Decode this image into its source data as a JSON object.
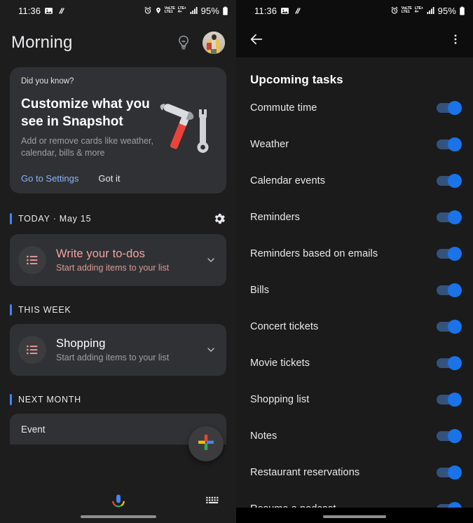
{
  "status_bar": {
    "time": "11:36",
    "icons_left": [
      "image-icon",
      "do-not-disturb-slash-icon"
    ],
    "alarm_icon": "alarm-icon",
    "location_icon": "location-pin-icon",
    "network_line1": "VoLTE",
    "network_line2": "LTE1",
    "network_badge1": "LTE+",
    "network_badge2": "4+",
    "signal_icon": "signal-bars-icon",
    "battery_text": "95%",
    "battery_icon": "battery-icon"
  },
  "left_screen": {
    "greeting": "Morning",
    "bulb_icon": "lightbulb-icon",
    "avatar_label": "account-avatar",
    "promo": {
      "eyebrow": "Did you know?",
      "title": "Customize what you see in Snapshot",
      "subtitle": "Add or remove cards like weather, calendar, bills & more",
      "primary_action": "Go to Settings",
      "secondary_action": "Got it",
      "art": "hammer-and-wrench-illustration"
    },
    "sections": [
      {
        "label": "TODAY · May 15",
        "has_gear": true,
        "gear_icon": "settings-gear-icon",
        "card": {
          "title": "Write your to-dos",
          "subtitle": "Start adding items to your list",
          "icon": "bullet-list-icon",
          "accent": "pink",
          "chevron": "chevron-down-icon"
        }
      },
      {
        "label": "THIS WEEK",
        "has_gear": false,
        "card": {
          "title": "Shopping",
          "subtitle": "Start adding items to your list",
          "icon": "bullet-list-icon",
          "accent": "white",
          "chevron": "chevron-down-icon"
        }
      },
      {
        "label": "NEXT MONTH",
        "has_gear": false,
        "event_card_label": "Event"
      }
    ],
    "fab": {
      "icon": "google-plus-add-icon",
      "label": "add"
    },
    "bottom_bar": {
      "mic_icon": "google-assistant-mic-icon",
      "keyboard_icon": "keyboard-icon"
    },
    "accent_color": "#4285f4",
    "card_color": "#303134",
    "background_color": "#1d1d1d"
  },
  "right_screen": {
    "back_icon": "back-arrow-icon",
    "overflow_icon": "more-vertical-icon",
    "title": "Upcoming tasks",
    "toggle_on_color": "#1a73e8",
    "items": [
      {
        "label": "Commute time",
        "enabled": true
      },
      {
        "label": "Weather",
        "enabled": true
      },
      {
        "label": "Calendar events",
        "enabled": true
      },
      {
        "label": "Reminders",
        "enabled": true
      },
      {
        "label": "Reminders based on emails",
        "enabled": true
      },
      {
        "label": "Bills",
        "enabled": true
      },
      {
        "label": "Concert tickets",
        "enabled": true
      },
      {
        "label": "Movie tickets",
        "enabled": true
      },
      {
        "label": "Shopping list",
        "enabled": true
      },
      {
        "label": "Notes",
        "enabled": true
      },
      {
        "label": "Restaurant reservations",
        "enabled": true
      },
      {
        "label": "Resume a podcast",
        "enabled": true
      }
    ]
  }
}
